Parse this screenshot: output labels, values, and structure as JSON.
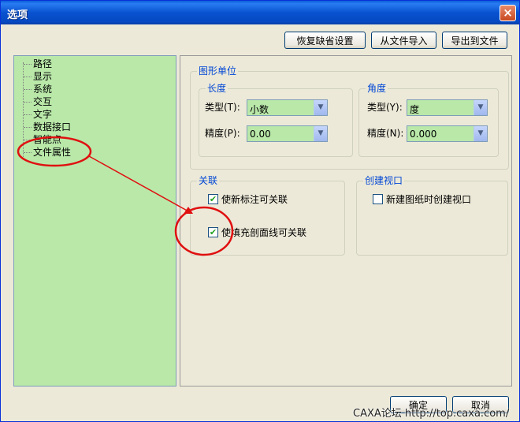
{
  "window": {
    "title": "选项",
    "close": "×"
  },
  "toolbar": {
    "restore_defaults": "恢复缺省设置",
    "import_file": "从文件导入",
    "export_file": "导出到文件"
  },
  "tree": {
    "items": [
      "路径",
      "显示",
      "系统",
      "交互",
      "文字",
      "数据接口",
      "智能点",
      "文件属性"
    ]
  },
  "units": {
    "legend": "图形单位",
    "length": {
      "legend": "长度",
      "type_label": "类型(T):",
      "type_value": "小数",
      "precision_label": "精度(P):",
      "precision_value": "0.00"
    },
    "angle": {
      "legend": "角度",
      "type_label": "类型(Y):",
      "type_value": "度",
      "precision_label": "精度(N):",
      "precision_value": "0.000"
    }
  },
  "association": {
    "legend": "关联",
    "option1": "使新标注可关联",
    "option1_checked": true,
    "option2": "使填充剖面线可关联",
    "option2_checked": true
  },
  "viewport": {
    "legend": "创建视口",
    "option": "新建图纸时创建视口",
    "option_checked": false
  },
  "footer": {
    "ok": "确定",
    "cancel": "取消"
  },
  "watermark": "CAXA论坛 http://top.caxa.com/",
  "annotation_color": "#e01010"
}
